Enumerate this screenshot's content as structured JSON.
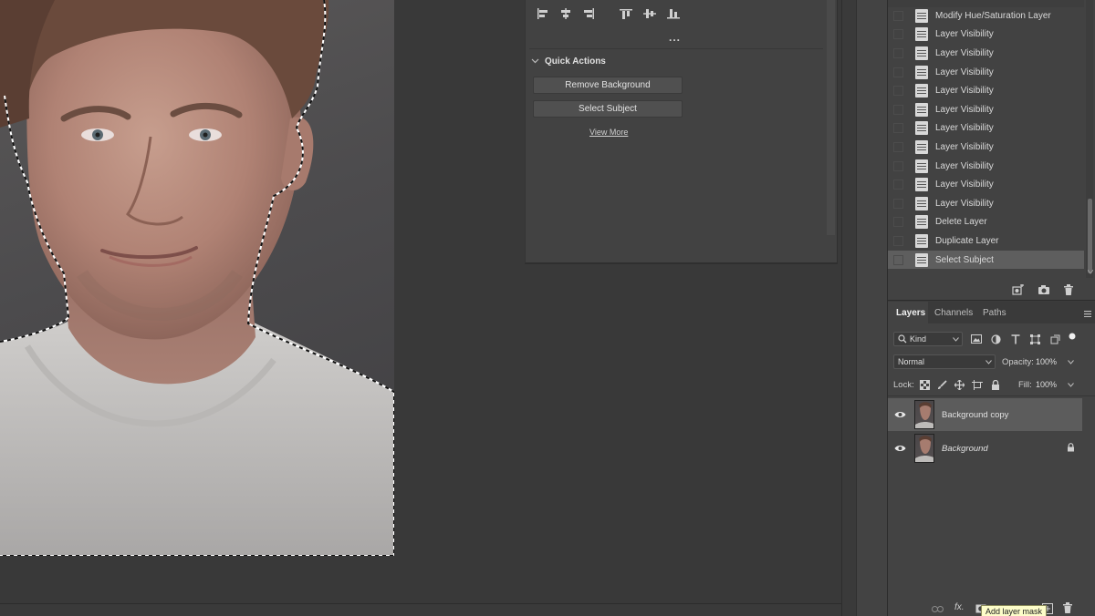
{
  "properties": {
    "quick_actions_label": "Quick Actions",
    "remove_background_label": "Remove Background",
    "select_subject_label": "Select Subject",
    "view_more_label": "View More",
    "more_options_label": "..."
  },
  "history": {
    "items": [
      "Modify Hue/Saturation Layer",
      "Layer Visibility",
      "Layer Visibility",
      "Layer Visibility",
      "Layer Visibility",
      "Layer Visibility",
      "Layer Visibility",
      "Layer Visibility",
      "Layer Visibility",
      "Layer Visibility",
      "Layer Visibility",
      "Delete Layer",
      "Duplicate Layer",
      "Select Subject"
    ],
    "selected_index": 13
  },
  "layers_panel": {
    "tabs": [
      "Layers",
      "Channels",
      "Paths"
    ],
    "active_tab": "Layers",
    "filter_kind": "Kind",
    "blend_mode": "Normal",
    "opacity_label": "Opacity:",
    "opacity_value": "100%",
    "lock_label": "Lock:",
    "fill_label": "Fill:",
    "fill_value": "100%",
    "layers": [
      {
        "name": "Background copy",
        "visible": true,
        "selected": true,
        "locked": false,
        "italic": false
      },
      {
        "name": "Background",
        "visible": true,
        "selected": false,
        "locked": true,
        "italic": true
      }
    ],
    "footer_fx_label": "fx.",
    "tooltip": "Add layer mask"
  },
  "colors": {
    "panel_bg": "#424242",
    "canvas_bg": "#393939",
    "selected_row": "#5e5e5e",
    "tooltip_bg": "#fdfdc9"
  }
}
